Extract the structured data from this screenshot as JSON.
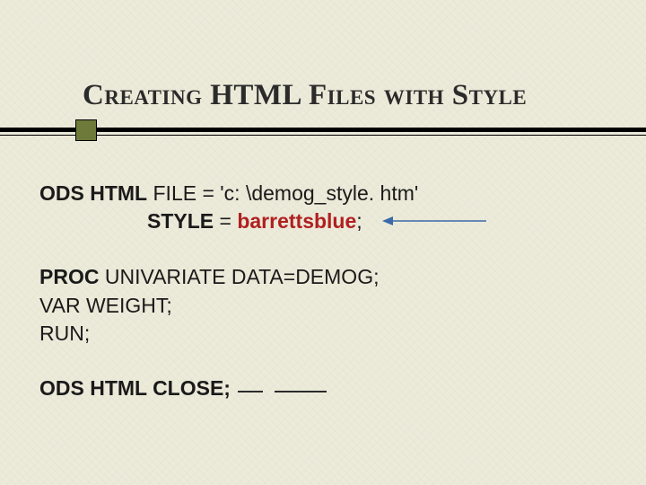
{
  "title": "Creating HTML Files with Style",
  "code": {
    "l1_kw": "ODS HTML",
    "l1_rest": " FILE = 'c: \\demog_style. htm'",
    "l2_kw": "STYLE",
    "l2_eq": " = ",
    "l2_val": "barrettsblue",
    "l2_semi": ";",
    "l3_kw": "PROC",
    "l3_rest": " UNIVARIATE DATA=DEMOG;",
    "l4": " VAR WEIGHT;",
    "l5": "RUN;",
    "l6": "ODS HTML CLOSE;"
  }
}
